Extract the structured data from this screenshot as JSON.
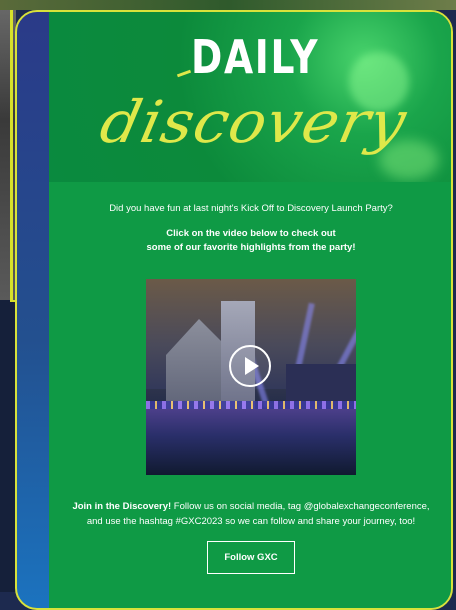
{
  "hero": {
    "title": "DAILY",
    "script": "discovery"
  },
  "intro_text": "Did you have fun at last night's Kick Off to Discovery Launch Party?",
  "cta": {
    "line1": "Click on the video below to check out",
    "line2": "some of our favorite highlights from the party!"
  },
  "video": {
    "play_icon": "play-icon"
  },
  "join": {
    "bold": "Join in the Discovery!",
    "text": " Follow us on social media, tag @globalexchangeconference, and use the hashtag #GXC2023 so we can follow and share your journey, too!"
  },
  "follow_button": "Follow GXC",
  "colors": {
    "email_green": "#0f9a45",
    "frame_yellow": "#d8e23a",
    "script_yellow": "#dfe84a"
  }
}
